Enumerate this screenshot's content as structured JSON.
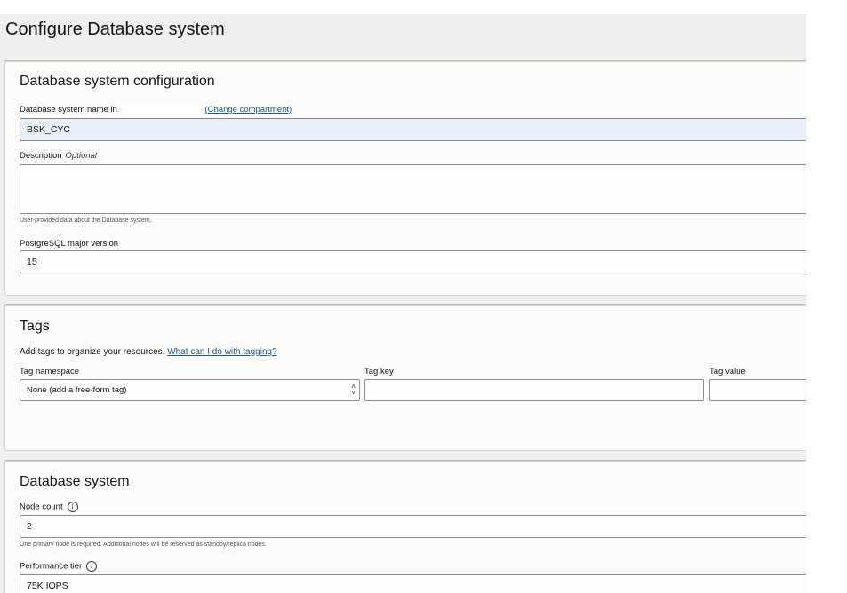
{
  "page": {
    "title": "Configure Database system"
  },
  "config": {
    "title": "Database system configuration",
    "name_label": "Database system name in",
    "change_compartment": "(Change compartment)",
    "name_value": "BSK_CYC",
    "description_label": "Description",
    "description_optional": "Optional",
    "description_value": "",
    "description_help": "User-provided data about the Database system.",
    "version_label": "PostgreSQL major version",
    "version_value": "15"
  },
  "tags": {
    "title": "Tags",
    "intro": "Add tags to organize your resources.",
    "intro_link": "What can I do with tagging?",
    "namespace_label": "Tag namespace",
    "namespace_value": "None (add a free-form tag)",
    "key_label": "Tag key",
    "key_value": "",
    "value_label": "Tag value",
    "value_value": ""
  },
  "dbsystem": {
    "title": "Database system",
    "node_count_label": "Node count",
    "node_count_value": "2",
    "node_count_help": "One primary node is required. Additional nodes will be reserved as standby/replica nodes.",
    "perf_label": "Performance tier",
    "perf_value": "75K IOPS"
  },
  "icons": {
    "info": "info-icon",
    "select_arrows": "chevron-up-down-icon"
  },
  "colors": {
    "link": "#1f5a8a",
    "filled_input_bg": "#e8effa",
    "page_bg": "#f1efed"
  }
}
